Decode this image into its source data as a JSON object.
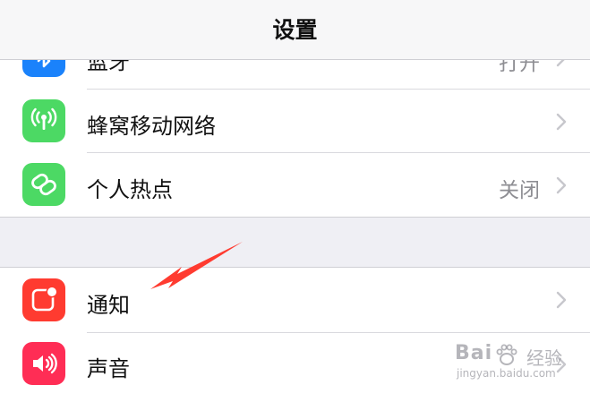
{
  "navbar": {
    "title": "设置"
  },
  "rows": [
    {
      "label": "蓝牙",
      "detail": "打开",
      "icon": "bluetooth-icon",
      "color": "#1a82fb"
    },
    {
      "label": "蜂窝移动网络",
      "detail": "",
      "icon": "antenna-icon",
      "color": "#4cd964"
    },
    {
      "label": "个人热点",
      "detail": "关闭",
      "icon": "chain-link-icon",
      "color": "#4cd964"
    },
    {
      "label": "通知",
      "detail": "",
      "icon": "notification-icon",
      "color": "#ff3b30"
    },
    {
      "label": "声音",
      "detail": "",
      "icon": "speaker-icon",
      "color": "#ff2d55"
    }
  ],
  "watermark": {
    "brand": "Bai",
    "cn": "经验",
    "url": "jingyan.baidu.com"
  }
}
